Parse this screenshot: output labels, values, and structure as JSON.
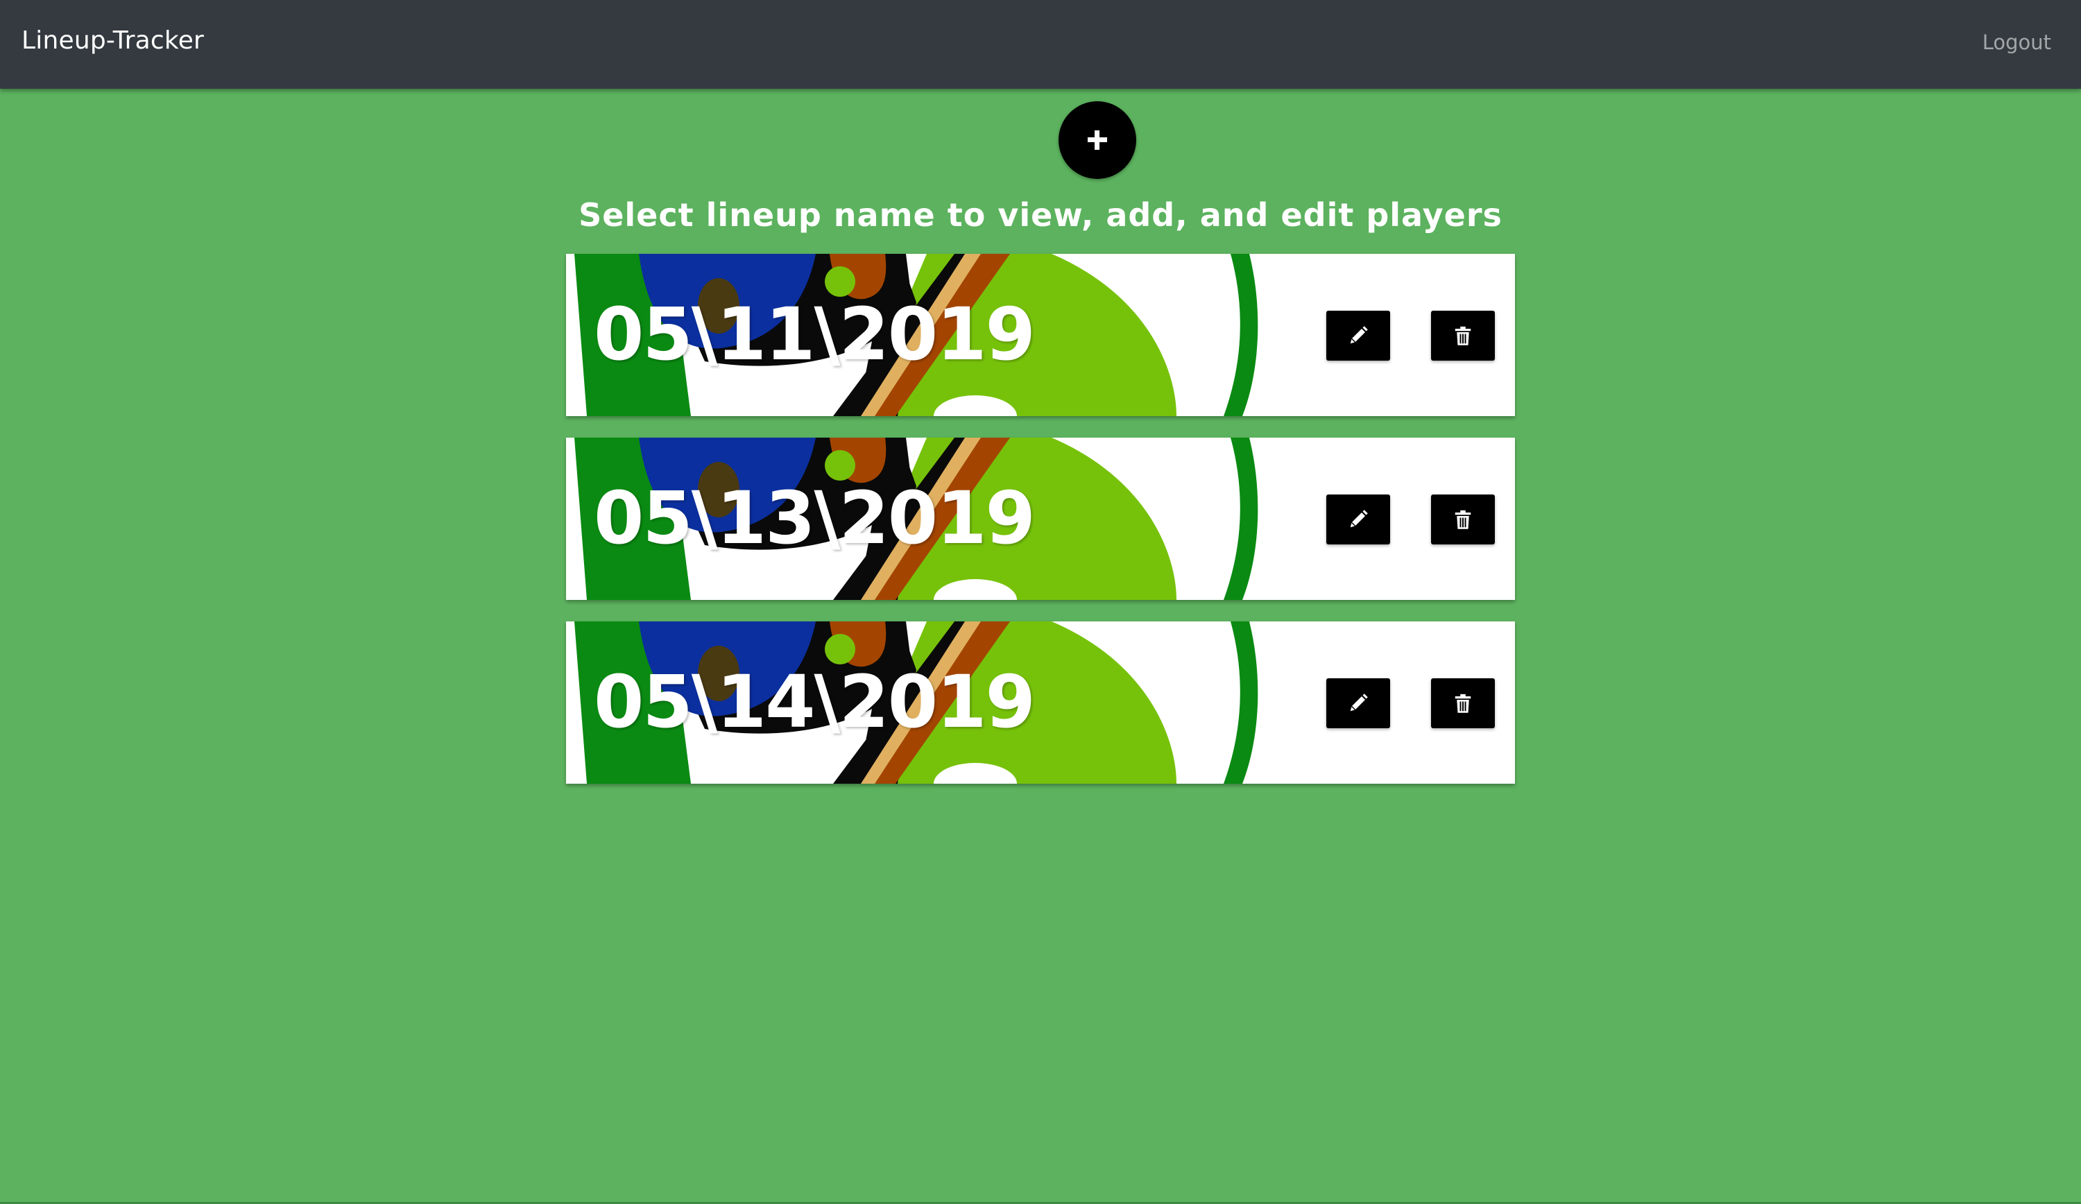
{
  "navbar": {
    "brand": "Lineup-Tracker",
    "logout_label": "Logout"
  },
  "add_button": {
    "icon": "plus-icon"
  },
  "heading": "Select lineup name to view, add, and edit players",
  "lineups": [
    {
      "name": "05\\11\\2019",
      "edit_icon": "pencil-icon",
      "delete_icon": "trash-icon"
    },
    {
      "name": "05\\13\\2019",
      "edit_icon": "pencil-icon",
      "delete_icon": "trash-icon"
    },
    {
      "name": "05\\14\\2019",
      "edit_icon": "pencil-icon",
      "delete_icon": "trash-icon"
    }
  ],
  "colors": {
    "background": "#5cb25e",
    "navbar": "#343a40",
    "button": "#000000"
  }
}
